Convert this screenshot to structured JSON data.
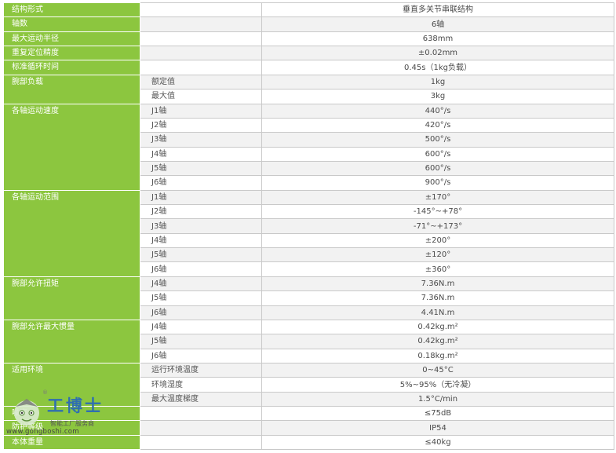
{
  "spec_table": [
    {
      "category": "结构形式",
      "rowspan": 1,
      "rows": [
        {
          "sub": "",
          "value": "垂直多关节串联结构"
        }
      ]
    },
    {
      "category": "轴数",
      "rowspan": 1,
      "rows": [
        {
          "sub": "",
          "value": "6轴"
        }
      ]
    },
    {
      "category": "最大运动半径",
      "rowspan": 1,
      "rows": [
        {
          "sub": "",
          "value": "638mm"
        }
      ]
    },
    {
      "category": "重复定位精度",
      "rowspan": 1,
      "rows": [
        {
          "sub": "",
          "value": "±0.02mm"
        }
      ]
    },
    {
      "category": "标准循环时间",
      "rowspan": 1,
      "rows": [
        {
          "sub": "",
          "value": "0.45s（1kg负载）"
        }
      ]
    },
    {
      "category": "腕部负载",
      "rowspan": 2,
      "rows": [
        {
          "sub": "额定值",
          "value": "1kg"
        },
        {
          "sub": "最大值",
          "value": "3kg"
        }
      ]
    },
    {
      "category": "各轴运动速度",
      "rowspan": 6,
      "rows": [
        {
          "sub": "J1轴",
          "value": "440°/s"
        },
        {
          "sub": "J2轴",
          "value": "420°/s"
        },
        {
          "sub": "J3轴",
          "value": "500°/s"
        },
        {
          "sub": "J4轴",
          "value": "600°/s"
        },
        {
          "sub": "J5轴",
          "value": "600°/s"
        },
        {
          "sub": "J6轴",
          "value": "900°/s"
        }
      ]
    },
    {
      "category": "各轴运动范围",
      "rowspan": 6,
      "rows": [
        {
          "sub": "J1轴",
          "value": "±170°"
        },
        {
          "sub": "J2轴",
          "value": "-145°~+78°"
        },
        {
          "sub": "J3轴",
          "value": "-71°~+173°"
        },
        {
          "sub": "J4轴",
          "value": "±200°"
        },
        {
          "sub": "J5轴",
          "value": "±120°"
        },
        {
          "sub": "J6轴",
          "value": "±360°"
        }
      ]
    },
    {
      "category": "腕部允许扭矩",
      "rowspan": 3,
      "rows": [
        {
          "sub": "J4轴",
          "value": "7.36N.m"
        },
        {
          "sub": "J5轴",
          "value": "7.36N.m"
        },
        {
          "sub": "J6轴",
          "value": "4.41N.m"
        }
      ]
    },
    {
      "category": "腕部允许最大惯量",
      "rowspan": 3,
      "rows": [
        {
          "sub": "J4轴",
          "value": "0.42kg.m²"
        },
        {
          "sub": "J5轴",
          "value": "0.42kg.m²"
        },
        {
          "sub": "J6轴",
          "value": "0.18kg.m²"
        }
      ]
    },
    {
      "category": "适用环境",
      "rowspan": 3,
      "rows": [
        {
          "sub": "运行环境温度",
          "value": "0~45°C"
        },
        {
          "sub": "环境湿度",
          "value": "5%~95%（无冷凝）"
        },
        {
          "sub": "最大温度梯度",
          "value": "1.5°C/min"
        }
      ]
    },
    {
      "category": "噪声",
      "rowspan": 1,
      "rows": [
        {
          "sub": "",
          "value": "≤75dB"
        }
      ]
    },
    {
      "category": "防护等级",
      "rowspan": 1,
      "rows": [
        {
          "sub": "",
          "value": "IP54"
        }
      ]
    },
    {
      "category": "本体重量",
      "rowspan": 1,
      "rows": [
        {
          "sub": "",
          "value": "≤40kg"
        }
      ]
    }
  ],
  "watermark": {
    "brand": "工博士",
    "registered": "®",
    "tagline": "智能工厂服务商",
    "url": "www.gongboshi.com"
  },
  "colors": {
    "category_bg": "#8cc63f",
    "category_text": "#ffffff",
    "border": "#c9c9c9",
    "shade_bg": "#f2f2f2",
    "brand_blue": "#2f6fb0"
  }
}
